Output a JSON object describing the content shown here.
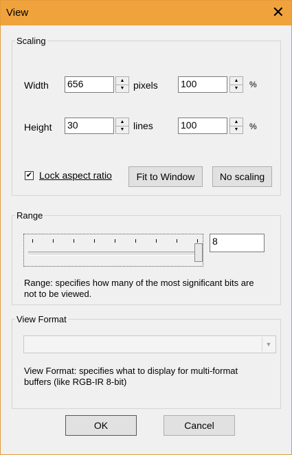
{
  "window": {
    "title": "View",
    "close_glyph": "✕"
  },
  "scaling": {
    "legend": "Scaling",
    "width_label": "Width",
    "width_value": "656",
    "width_unit": "pixels",
    "width_percent": "100",
    "percent_sign": "%",
    "height_label": "Height",
    "height_value": "30",
    "height_unit": "lines",
    "height_percent": "100",
    "lock_aspect_label": "Lock aspect ratio",
    "lock_aspect_checked": true,
    "fit_to_window_label": "Fit to Window",
    "no_scaling_label": "No scaling"
  },
  "range": {
    "legend": "Range",
    "slider_level": 1.0,
    "value": "8",
    "description": "Range: specifies how many of the most significant bits are not to be viewed."
  },
  "view_format": {
    "legend": "View Format",
    "selected_value": "",
    "description": "View Format: specifies what to display for multi-format buffers (like RGB-IR 8-bit)"
  },
  "buttons": {
    "ok_label": "OK",
    "cancel_label": "Cancel"
  },
  "colors": {
    "titlebar": "#f0a33c",
    "dialog_bg": "#f0f0f0",
    "button_bg": "#e1e1e1"
  }
}
